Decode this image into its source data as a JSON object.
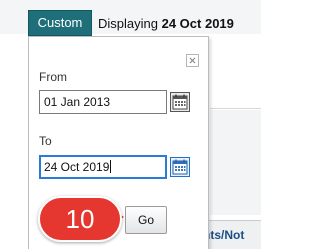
{
  "toolbar": {
    "custom_tab_label": "Custom",
    "displaying_prefix": "Displaying",
    "displaying_date": "24 Oct 2019"
  },
  "date_popup": {
    "close_icon": "close-icon",
    "from_label": "From",
    "from_value": "01 Jan 2013",
    "to_label": "To",
    "to_value": "24 Oct 2019",
    "calendar_icon": "calendar-icon",
    "go_label": "Go"
  },
  "step_badge": {
    "number": "10",
    "color": "#e5362f"
  },
  "background": {
    "link_text_partial": "nts/Not"
  },
  "colors": {
    "tab_accent": "#1f6f7a",
    "focus_border": "#2b7bd4"
  }
}
